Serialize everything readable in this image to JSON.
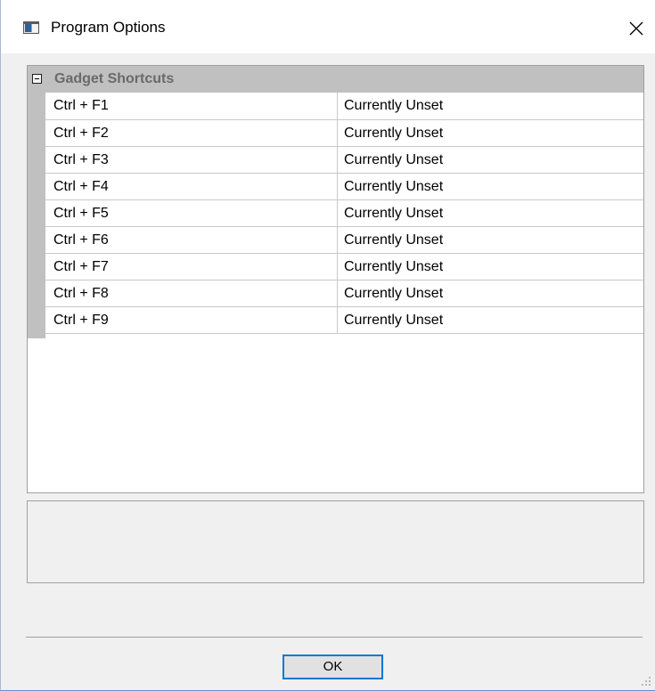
{
  "window": {
    "title": "Program Options",
    "icon": "app-window-icon",
    "close_icon": "close-icon"
  },
  "property_grid": {
    "category": {
      "label": "Gadget Shortcuts",
      "expander_icon": "collapse-minus-icon",
      "expanded": true
    },
    "rows": [
      {
        "name": "Ctrl + F1",
        "value": "Currently Unset"
      },
      {
        "name": "Ctrl + F2",
        "value": "Currently Unset"
      },
      {
        "name": "Ctrl + F3",
        "value": "Currently Unset"
      },
      {
        "name": "Ctrl + F4",
        "value": "Currently Unset"
      },
      {
        "name": "Ctrl + F5",
        "value": "Currently Unset"
      },
      {
        "name": "Ctrl + F6",
        "value": "Currently Unset"
      },
      {
        "name": "Ctrl + F7",
        "value": "Currently Unset"
      },
      {
        "name": "Ctrl + F8",
        "value": "Currently Unset"
      },
      {
        "name": "Ctrl + F9",
        "value": "Currently Unset"
      }
    ]
  },
  "description_panel": {
    "text": ""
  },
  "footer": {
    "ok_label": "OK",
    "resize_grip_icon": "resize-grip-icon"
  },
  "colors": {
    "background": "#f0f0f0",
    "category_header": "#c0c0c0",
    "category_text": "#6a6a6a",
    "focus_border": "#0078d7",
    "button_face": "#e1e1e1"
  }
}
